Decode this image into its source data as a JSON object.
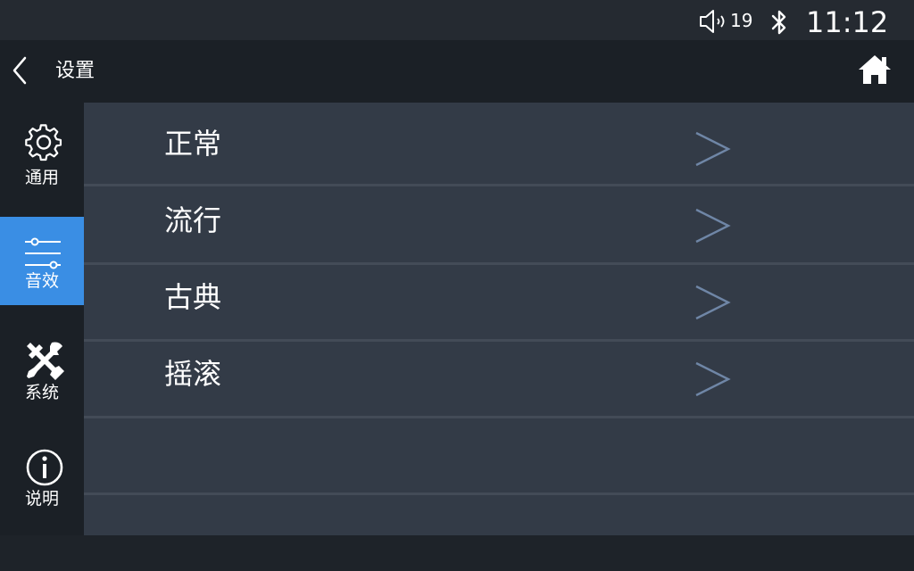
{
  "status_bar": {
    "volume_level": "19",
    "time": "11:12",
    "icons": [
      "speaker-icon",
      "bluetooth-icon"
    ]
  },
  "title_bar": {
    "title": "设置",
    "icons": [
      "back-chevron-icon",
      "home-icon"
    ]
  },
  "sidebar": {
    "items": [
      {
        "label": "通用",
        "icon": "gear-icon",
        "active": false
      },
      {
        "label": "音效",
        "icon": "equalizer-sliders-icon",
        "active": true
      },
      {
        "label": "系统",
        "icon": "wrench-screwdriver-icon",
        "active": false
      },
      {
        "label": "说明",
        "icon": "info-icon",
        "active": false
      }
    ]
  },
  "sound_presets": {
    "items": [
      {
        "label": "正常"
      },
      {
        "label": "流行"
      },
      {
        "label": "古典"
      },
      {
        "label": "摇滚"
      }
    ]
  },
  "colors": {
    "active_accent": "#3a8ee4",
    "content_bg": "#333b47",
    "chevron": "#6f86a6"
  }
}
